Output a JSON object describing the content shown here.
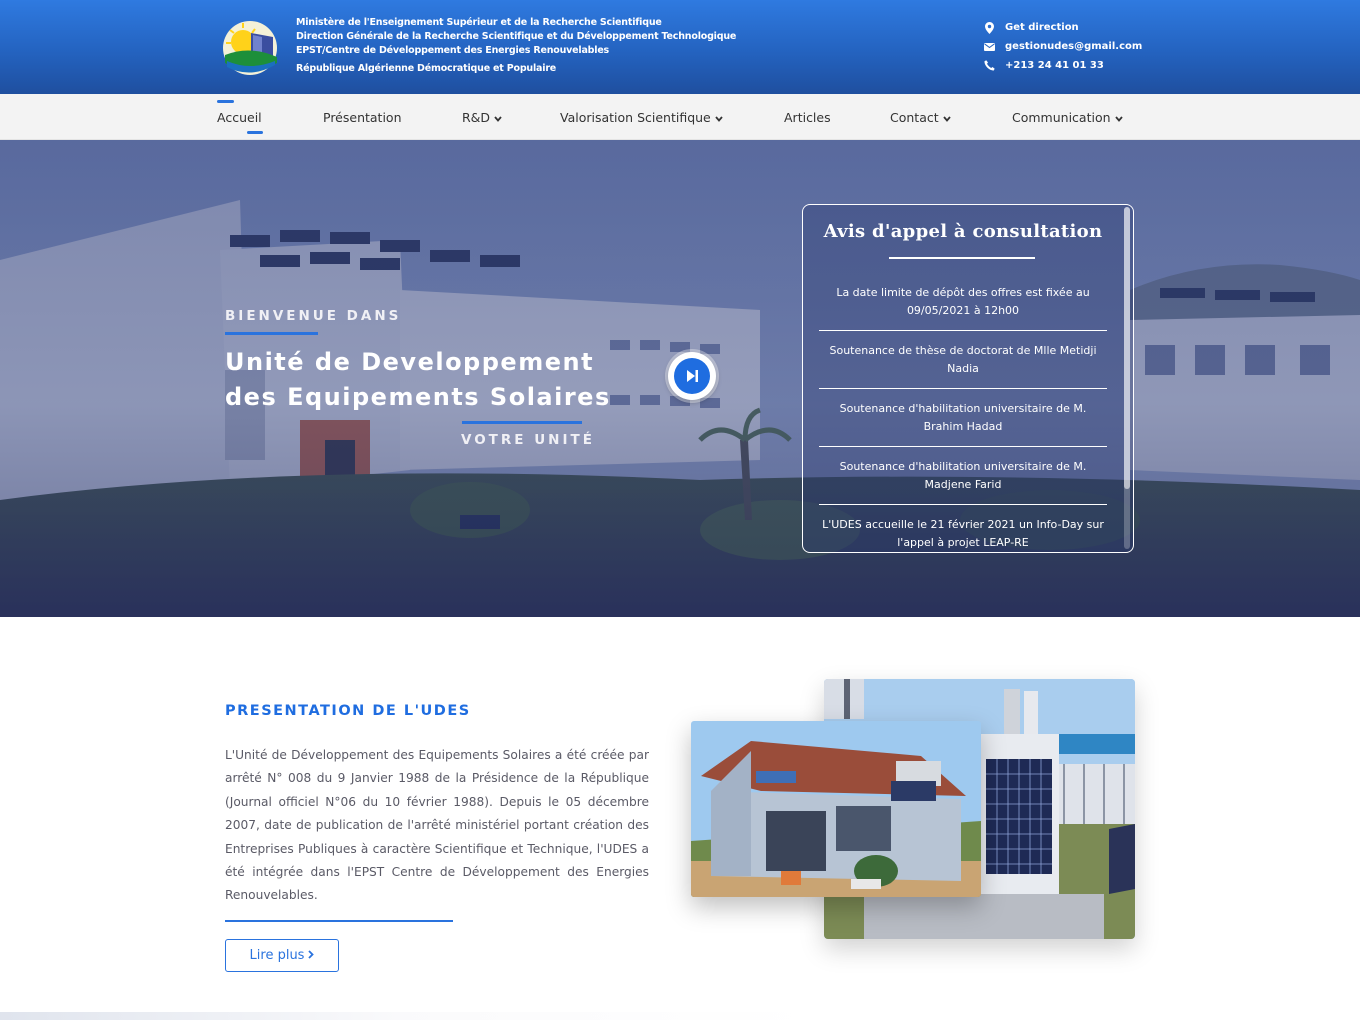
{
  "header": {
    "org_lines": [
      "Ministère de l'Enseignement Supérieur et de la Recherche Scientifique",
      "Direction Générale de la Recherche Scientifique et du Développement Technologique",
      "EPST/Centre de Développement des Energies Renouvelables",
      "République Algérienne Démocratique et Populaire"
    ],
    "contacts": {
      "direction": "Get direction",
      "email": "gestionudes@gmail.com",
      "phone": "+213 24 41 01 33"
    }
  },
  "nav": {
    "items": [
      {
        "label": "Accueil",
        "dropdown": false,
        "active": true
      },
      {
        "label": "Présentation",
        "dropdown": false
      },
      {
        "label": "R&D",
        "dropdown": true
      },
      {
        "label": "Valorisation Scientifique",
        "dropdown": true
      },
      {
        "label": "Articles",
        "dropdown": false
      },
      {
        "label": "Contact",
        "dropdown": true
      },
      {
        "label": "Communication",
        "dropdown": true
      }
    ]
  },
  "hero": {
    "kicker": "BIENVENUE DANS",
    "title_line1": "Unité de Developpement",
    "title_line2": "des Equipements Solaires",
    "subtitle": "VOTRE UNITÉ"
  },
  "avis": {
    "title": "Avis d'appel à consultation",
    "items": [
      "La date limite de dépôt des offres est fixée au 09/05/2021 à 12h00",
      "Soutenance de thèse de doctorat de Mlle Metidji Nadia",
      "Soutenance d'habilitation universitaire de M. Brahim Hadad",
      "Soutenance d'habilitation universitaire de M. Madjene Farid",
      "L'UDES accueille le 21 février 2021 un Info-Day sur l'appel à projet LEAP-RE"
    ]
  },
  "presentation": {
    "title": "PRESENTATION DE L'UDES",
    "text": "L'Unité de Développement des Equipements Solaires a été créée par arrêté N° 008 du 9 Janvier 1988 de la Présidence de la République (Journal officiel N°06 du 10 février 1988). Depuis le 05 décembre 2007, date de publication de l'arrêté ministériel portant création des Entreprises Publiques à caractère Scientifique et Technique, l'UDES a été intégrée dans l'EPST Centre de Développement des Energies Renouvelables.",
    "button": "Lire plus"
  },
  "colors": {
    "brand_blue": "#2a73de",
    "header_top": "#2f7ae0",
    "header_bottom": "#1f4f9f",
    "nav_bg": "#f3f3f3"
  },
  "icons": [
    "logo",
    "map-pin-icon",
    "envelope-icon",
    "phone-icon",
    "chevron-down-icon",
    "play-next-icon",
    "chevron-right-icon"
  ]
}
